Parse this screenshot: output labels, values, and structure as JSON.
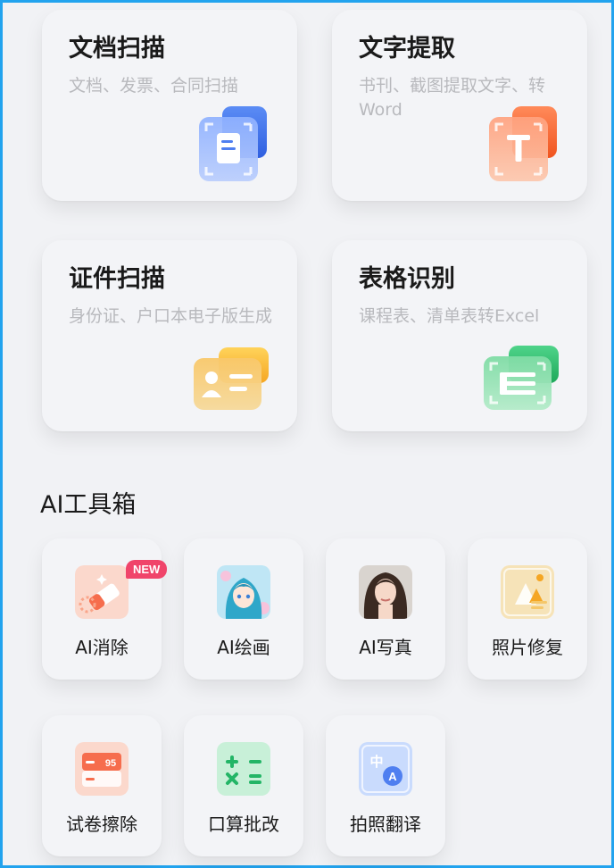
{
  "cards": [
    {
      "title": "文档扫描",
      "subtitle": "文档、发票、合同扫描",
      "icon": "document-scan-icon",
      "color": "#4f7ff0"
    },
    {
      "title": "文字提取",
      "subtitle": "书刊、截图提取文字、转Word",
      "icon": "text-extract-icon",
      "color": "#f26b3b"
    },
    {
      "title": "证件扫描",
      "subtitle": "身份证、户口本电子版生成",
      "icon": "id-card-icon",
      "color": "#f2b63b"
    },
    {
      "title": "表格识别",
      "subtitle": "课程表、清单表转Excel",
      "icon": "table-recognize-icon",
      "color": "#2fbf6b"
    }
  ],
  "section_title": "AI工具箱",
  "tools": [
    {
      "label": "AI消除",
      "badge": "NEW",
      "icon": "eraser-icon"
    },
    {
      "label": "AI绘画",
      "icon": "anime-portrait-icon"
    },
    {
      "label": "AI写真",
      "icon": "portrait-photo-icon"
    },
    {
      "label": "照片修复",
      "icon": "photo-repair-icon"
    },
    {
      "label": "试卷擦除",
      "icon": "exam-erase-icon",
      "icon_text": "95"
    },
    {
      "label": "口算批改",
      "icon": "math-correct-icon"
    },
    {
      "label": "拍照翻译",
      "icon": "photo-translate-icon",
      "icon_text_1": "中",
      "icon_text_2": "A"
    }
  ]
}
